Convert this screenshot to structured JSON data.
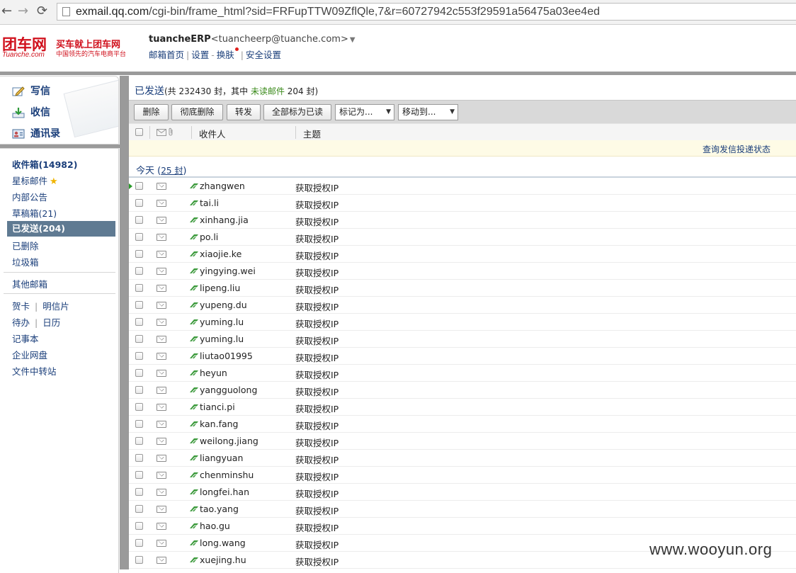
{
  "browser": {
    "back_glyph": "←",
    "forward_glyph": "→",
    "reload_glyph": "⟳",
    "url_host": "exmail.qq.com",
    "url_path": "/cgi-bin/frame_html?sid=FRFupTTW09ZflQle,7&r=60727942c553f29591a56475a03ee4ed"
  },
  "logo": {
    "main": "团车网",
    "sub": "Tuanche.com",
    "slogan1": "买车就上团车网",
    "slogan2": "中国领先的汽车电商平台"
  },
  "account": {
    "name": "tuancheERP",
    "email": "<tuancheerp@tuanche.com>",
    "caret": "▼",
    "links": [
      "邮箱首页",
      "设置",
      "换肤",
      "安全设置"
    ],
    "sep1": "|",
    "sep2": "-",
    "sep3": "|"
  },
  "quick_actions": {
    "compose": "写信",
    "inbox": "收信",
    "contacts": "通讯录"
  },
  "folders": {
    "inbox": "收件箱(14982)",
    "starred": "星标邮件",
    "star_glyph": "★",
    "announcements": "内部公告",
    "drafts": "草稿箱(21)",
    "sent": "已发送(204)",
    "deleted": "已删除",
    "spam": "垃圾箱",
    "other": "其他邮箱",
    "greeting_card": "贺卡",
    "postcard": "明信片",
    "todo": "待办",
    "calendar": "日历",
    "notes": "记事本",
    "netdisk": "企业网盘",
    "file_transfer": "文件中转站",
    "sep": "|"
  },
  "main": {
    "title": "已发送",
    "title_summary_a": "(共 232430 封，其中 ",
    "title_unread": "未读邮件",
    "title_summary_b": " 204 封)",
    "toolbar": {
      "delete": "删除",
      "delete_forever": "彻底删除",
      "forward": "转发",
      "mark_all_read": "全部标为已读",
      "mark_as": "标记为...",
      "move_to": "移动到...",
      "dd_glyph": "▼"
    },
    "columns": {
      "recipient": "收件人",
      "subject": "主题"
    },
    "notice": "查询发信投递状态",
    "group_label": "今天",
    "group_count": "25 封",
    "group_open": "(",
    "group_close": ")",
    "rows": [
      {
        "recipient": "zhangwen",
        "subject": "获取授权IP"
      },
      {
        "recipient": "tai.li",
        "subject": "获取授权IP"
      },
      {
        "recipient": "xinhang.jia",
        "subject": "获取授权IP"
      },
      {
        "recipient": "po.li",
        "subject": "获取授权IP"
      },
      {
        "recipient": "xiaojie.ke",
        "subject": "获取授权IP"
      },
      {
        "recipient": "yingying.wei",
        "subject": "获取授权IP"
      },
      {
        "recipient": "lipeng.liu",
        "subject": "获取授权IP"
      },
      {
        "recipient": "yupeng.du",
        "subject": "获取授权IP"
      },
      {
        "recipient": "yuming.lu",
        "subject": "获取授权IP"
      },
      {
        "recipient": "yuming.lu",
        "subject": "获取授权IP"
      },
      {
        "recipient": "liutao01995",
        "subject": "获取授权IP"
      },
      {
        "recipient": "heyun",
        "subject": "获取授权IP"
      },
      {
        "recipient": "yangguolong",
        "subject": "获取授权IP"
      },
      {
        "recipient": "tianci.pi",
        "subject": "获取授权IP"
      },
      {
        "recipient": "kan.fang",
        "subject": "获取授权IP"
      },
      {
        "recipient": "weilong.jiang",
        "subject": "获取授权IP"
      },
      {
        "recipient": "liangyuan",
        "subject": "获取授权IP"
      },
      {
        "recipient": "chenminshu",
        "subject": "获取授权IP"
      },
      {
        "recipient": "longfei.han",
        "subject": "获取授权IP"
      },
      {
        "recipient": "tao.yang",
        "subject": "获取授权IP"
      },
      {
        "recipient": "hao.gu",
        "subject": "获取授权IP"
      },
      {
        "recipient": "long.wang",
        "subject": "获取授权IP"
      },
      {
        "recipient": "xuejing.hu",
        "subject": "获取授权IP"
      }
    ]
  },
  "watermark": "www.wooyun.org",
  "colors": {
    "brand_red": "#d0101c",
    "link_blue": "#1a3e7a",
    "selected_folder": "#5f7a92",
    "unread_green": "#3a8a1a",
    "sent_icon_green": "#3c9a3c"
  }
}
